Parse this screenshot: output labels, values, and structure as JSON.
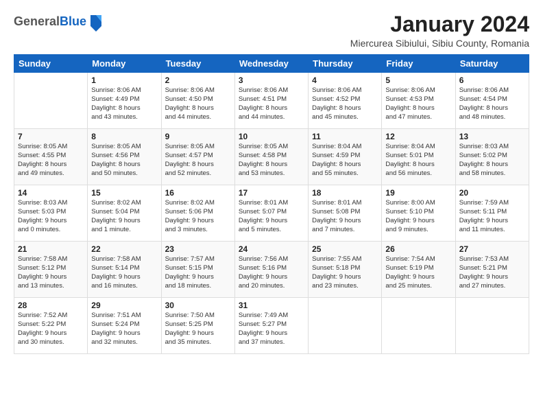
{
  "header": {
    "logo_general": "General",
    "logo_blue": "Blue",
    "month_title": "January 2024",
    "location": "Miercurea Sibiului, Sibiu County, Romania"
  },
  "weekdays": [
    "Sunday",
    "Monday",
    "Tuesday",
    "Wednesday",
    "Thursday",
    "Friday",
    "Saturday"
  ],
  "weeks": [
    [
      {
        "day": "",
        "info": ""
      },
      {
        "day": "1",
        "info": "Sunrise: 8:06 AM\nSunset: 4:49 PM\nDaylight: 8 hours\nand 43 minutes."
      },
      {
        "day": "2",
        "info": "Sunrise: 8:06 AM\nSunset: 4:50 PM\nDaylight: 8 hours\nand 44 minutes."
      },
      {
        "day": "3",
        "info": "Sunrise: 8:06 AM\nSunset: 4:51 PM\nDaylight: 8 hours\nand 44 minutes."
      },
      {
        "day": "4",
        "info": "Sunrise: 8:06 AM\nSunset: 4:52 PM\nDaylight: 8 hours\nand 45 minutes."
      },
      {
        "day": "5",
        "info": "Sunrise: 8:06 AM\nSunset: 4:53 PM\nDaylight: 8 hours\nand 47 minutes."
      },
      {
        "day": "6",
        "info": "Sunrise: 8:06 AM\nSunset: 4:54 PM\nDaylight: 8 hours\nand 48 minutes."
      }
    ],
    [
      {
        "day": "7",
        "info": "Sunrise: 8:05 AM\nSunset: 4:55 PM\nDaylight: 8 hours\nand 49 minutes."
      },
      {
        "day": "8",
        "info": "Sunrise: 8:05 AM\nSunset: 4:56 PM\nDaylight: 8 hours\nand 50 minutes."
      },
      {
        "day": "9",
        "info": "Sunrise: 8:05 AM\nSunset: 4:57 PM\nDaylight: 8 hours\nand 52 minutes."
      },
      {
        "day": "10",
        "info": "Sunrise: 8:05 AM\nSunset: 4:58 PM\nDaylight: 8 hours\nand 53 minutes."
      },
      {
        "day": "11",
        "info": "Sunrise: 8:04 AM\nSunset: 4:59 PM\nDaylight: 8 hours\nand 55 minutes."
      },
      {
        "day": "12",
        "info": "Sunrise: 8:04 AM\nSunset: 5:01 PM\nDaylight: 8 hours\nand 56 minutes."
      },
      {
        "day": "13",
        "info": "Sunrise: 8:03 AM\nSunset: 5:02 PM\nDaylight: 8 hours\nand 58 minutes."
      }
    ],
    [
      {
        "day": "14",
        "info": "Sunrise: 8:03 AM\nSunset: 5:03 PM\nDaylight: 9 hours\nand 0 minutes."
      },
      {
        "day": "15",
        "info": "Sunrise: 8:02 AM\nSunset: 5:04 PM\nDaylight: 9 hours\nand 1 minute."
      },
      {
        "day": "16",
        "info": "Sunrise: 8:02 AM\nSunset: 5:06 PM\nDaylight: 9 hours\nand 3 minutes."
      },
      {
        "day": "17",
        "info": "Sunrise: 8:01 AM\nSunset: 5:07 PM\nDaylight: 9 hours\nand 5 minutes."
      },
      {
        "day": "18",
        "info": "Sunrise: 8:01 AM\nSunset: 5:08 PM\nDaylight: 9 hours\nand 7 minutes."
      },
      {
        "day": "19",
        "info": "Sunrise: 8:00 AM\nSunset: 5:10 PM\nDaylight: 9 hours\nand 9 minutes."
      },
      {
        "day": "20",
        "info": "Sunrise: 7:59 AM\nSunset: 5:11 PM\nDaylight: 9 hours\nand 11 minutes."
      }
    ],
    [
      {
        "day": "21",
        "info": "Sunrise: 7:58 AM\nSunset: 5:12 PM\nDaylight: 9 hours\nand 13 minutes."
      },
      {
        "day": "22",
        "info": "Sunrise: 7:58 AM\nSunset: 5:14 PM\nDaylight: 9 hours\nand 16 minutes."
      },
      {
        "day": "23",
        "info": "Sunrise: 7:57 AM\nSunset: 5:15 PM\nDaylight: 9 hours\nand 18 minutes."
      },
      {
        "day": "24",
        "info": "Sunrise: 7:56 AM\nSunset: 5:16 PM\nDaylight: 9 hours\nand 20 minutes."
      },
      {
        "day": "25",
        "info": "Sunrise: 7:55 AM\nSunset: 5:18 PM\nDaylight: 9 hours\nand 23 minutes."
      },
      {
        "day": "26",
        "info": "Sunrise: 7:54 AM\nSunset: 5:19 PM\nDaylight: 9 hours\nand 25 minutes."
      },
      {
        "day": "27",
        "info": "Sunrise: 7:53 AM\nSunset: 5:21 PM\nDaylight: 9 hours\nand 27 minutes."
      }
    ],
    [
      {
        "day": "28",
        "info": "Sunrise: 7:52 AM\nSunset: 5:22 PM\nDaylight: 9 hours\nand 30 minutes."
      },
      {
        "day": "29",
        "info": "Sunrise: 7:51 AM\nSunset: 5:24 PM\nDaylight: 9 hours\nand 32 minutes."
      },
      {
        "day": "30",
        "info": "Sunrise: 7:50 AM\nSunset: 5:25 PM\nDaylight: 9 hours\nand 35 minutes."
      },
      {
        "day": "31",
        "info": "Sunrise: 7:49 AM\nSunset: 5:27 PM\nDaylight: 9 hours\nand 37 minutes."
      },
      {
        "day": "",
        "info": ""
      },
      {
        "day": "",
        "info": ""
      },
      {
        "day": "",
        "info": ""
      }
    ]
  ]
}
